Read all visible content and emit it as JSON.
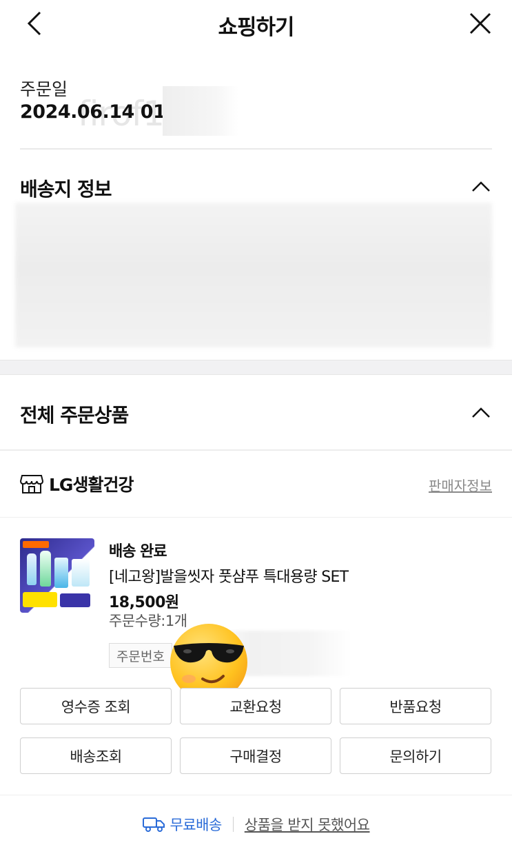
{
  "header": {
    "title": "쇼핑하기"
  },
  "order": {
    "date_label": "주문일",
    "date_value": "2024.06.14 01:2",
    "watermark": "firof1st"
  },
  "shipping": {
    "title": "배송지 정보"
  },
  "products_section": {
    "title": "전체 주문상품"
  },
  "seller": {
    "name": "LG생활건강",
    "info_link": "판매자정보"
  },
  "item": {
    "status": "배송 완료",
    "name": "[네고왕]발을씻자 풋샴푸 특대용량 SET",
    "price": "18,500원",
    "quantity": "주문수량:1개",
    "order_number_label": "주문번호"
  },
  "actions": {
    "row1": [
      "영수증 조회",
      "교환요청",
      "반품요청"
    ],
    "row2": [
      "배송조회",
      "구매결정",
      "문의하기"
    ]
  },
  "footer": {
    "free_shipping": "무료배송",
    "not_received": "상품을 받지 못했어요"
  },
  "colors": {
    "link_blue": "#2a6bd8",
    "divider": "#e9e9e9",
    "band": "#f1f1f3"
  }
}
